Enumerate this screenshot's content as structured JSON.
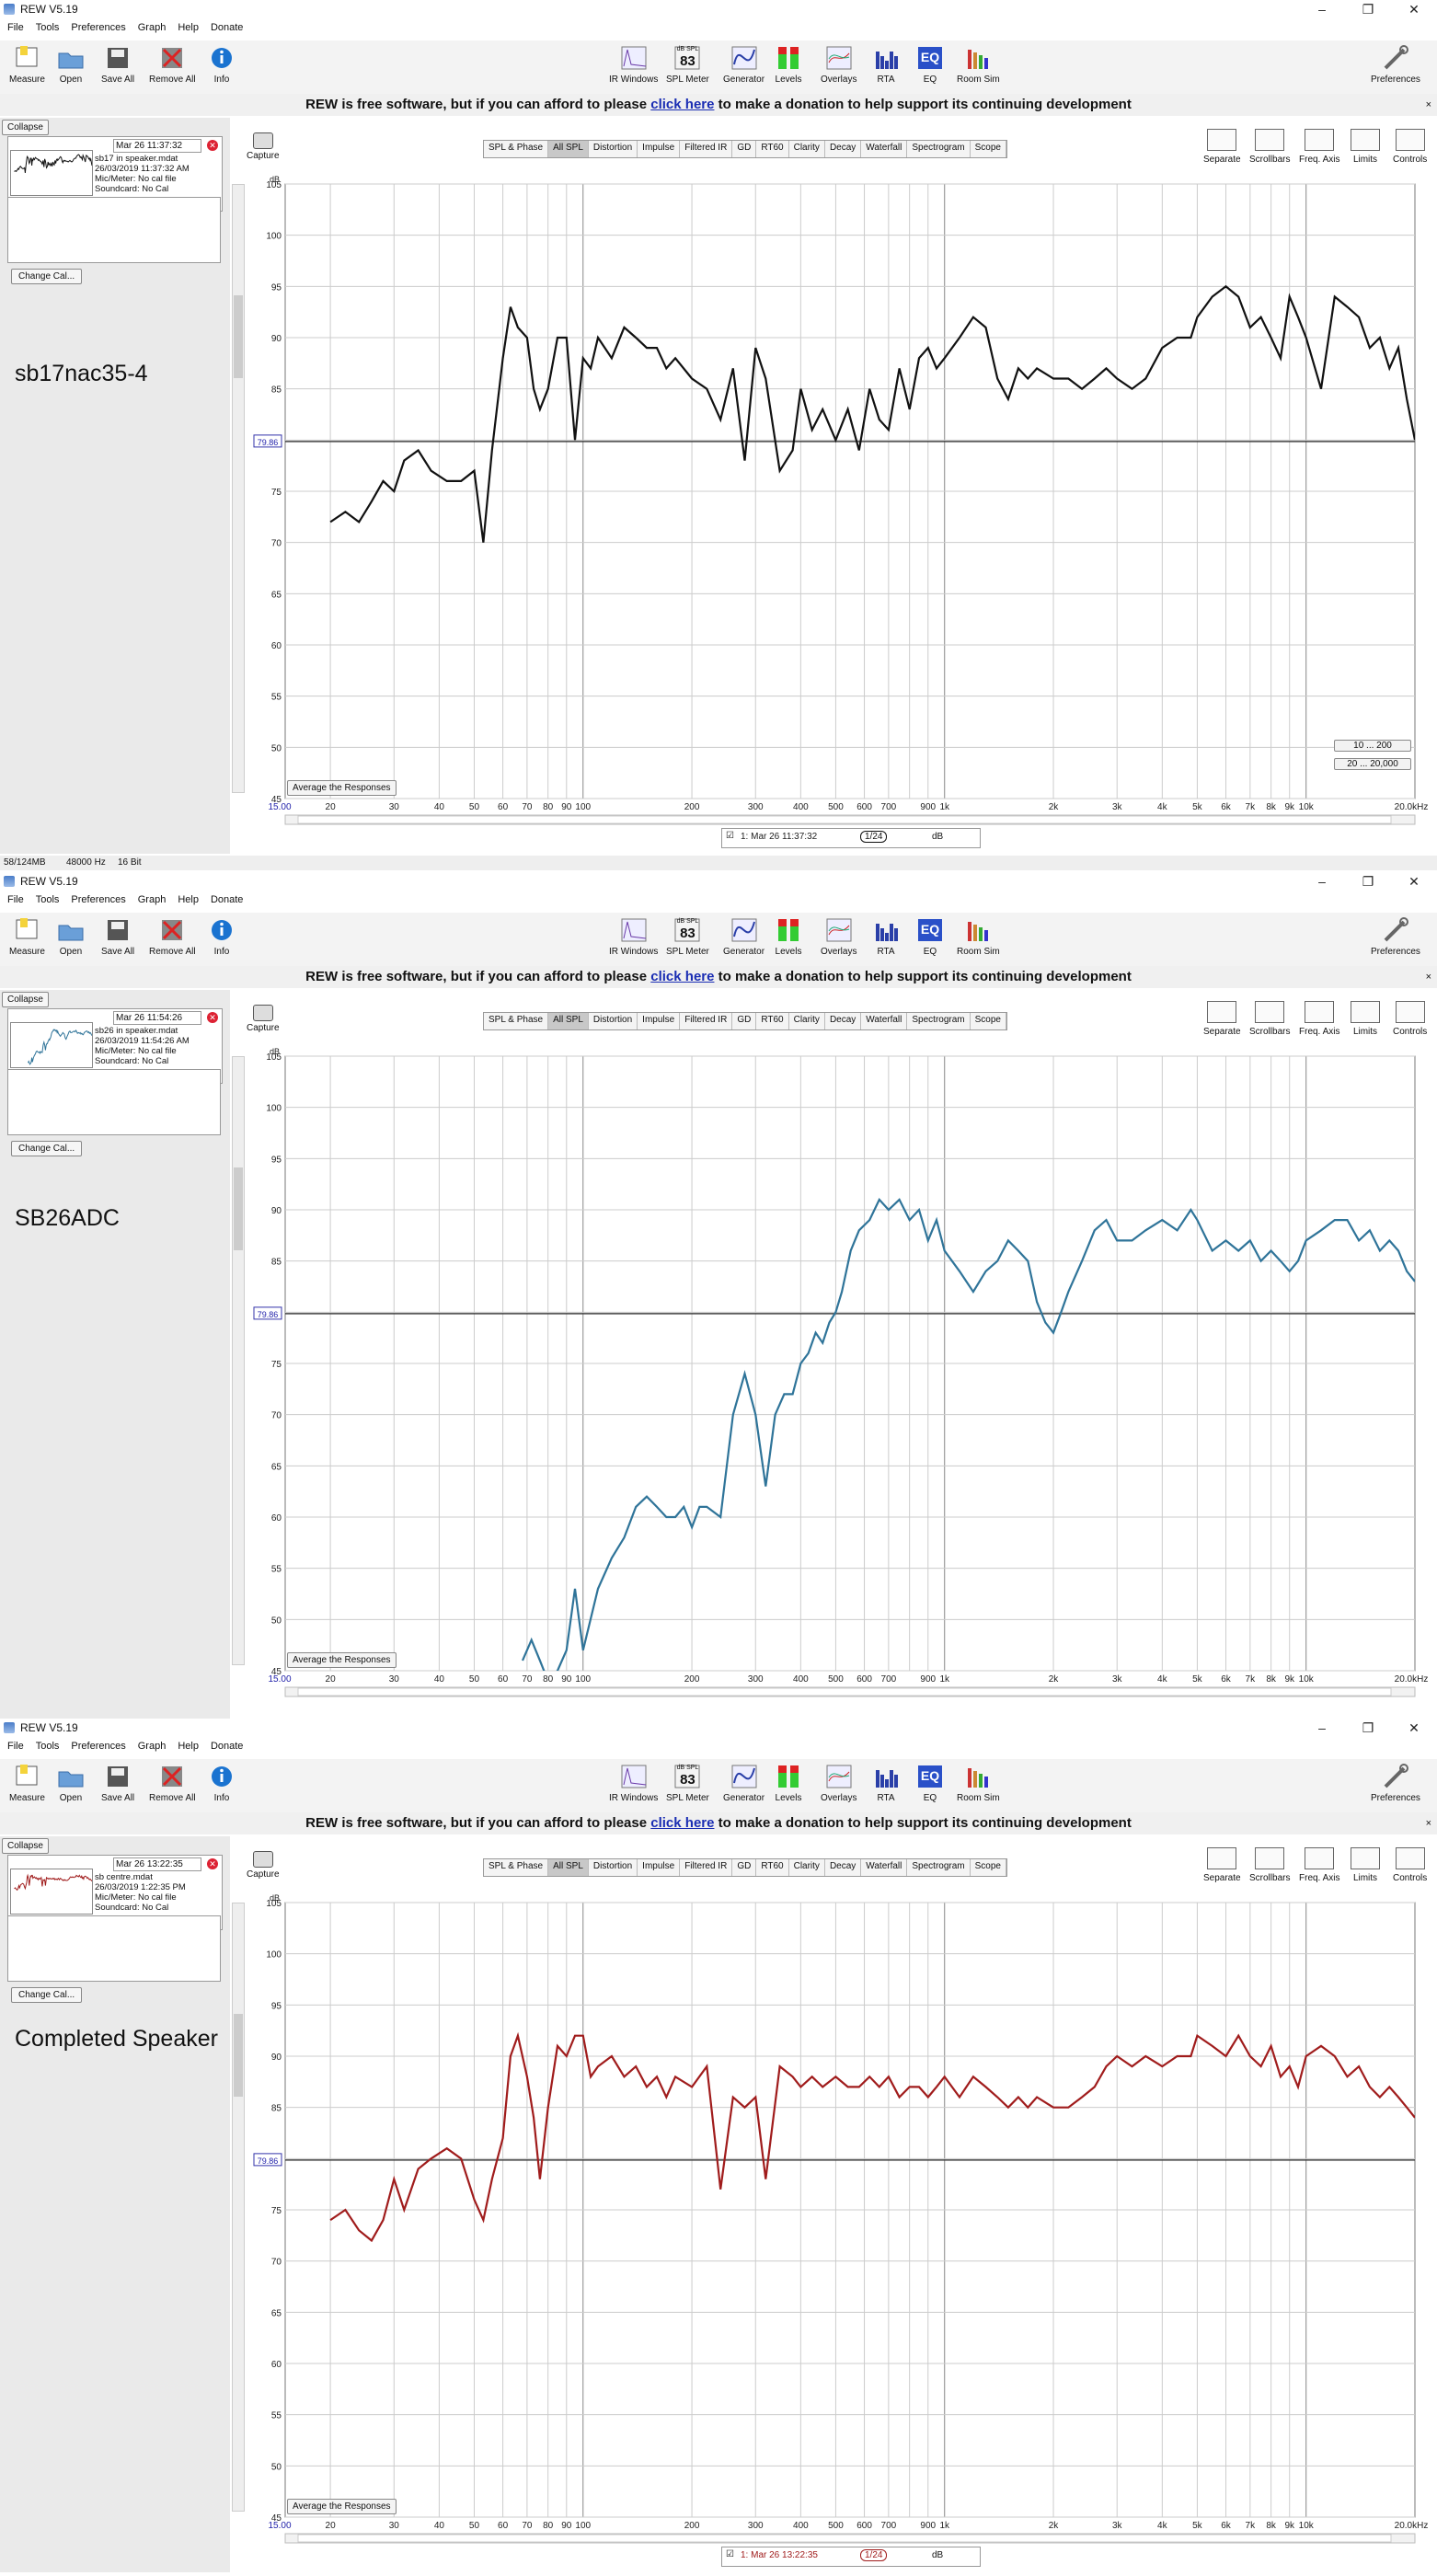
{
  "app": {
    "title": "REW V5.19",
    "menu": [
      "File",
      "Tools",
      "Preferences",
      "Graph",
      "Help",
      "Donate"
    ],
    "toolbar_left": [
      {
        "label": "Measure",
        "icon": "measure-icon"
      },
      {
        "label": "Open",
        "icon": "open-folder-icon"
      },
      {
        "label": "Save All",
        "icon": "save-icon"
      },
      {
        "label": "Remove All",
        "icon": "remove-icon"
      },
      {
        "label": "Info",
        "icon": "info-icon"
      }
    ],
    "toolbar_center": [
      {
        "label": "IR Windows",
        "icon": "ir-windows-icon"
      },
      {
        "label": "SPL Meter",
        "icon": "spl-meter-icon",
        "badge_top": "dB SPL",
        "badge": "83"
      },
      {
        "label": "Generator",
        "icon": "generator-icon"
      },
      {
        "label": "Levels",
        "icon": "levels-icon"
      },
      {
        "label": "Overlays",
        "icon": "overlays-icon"
      },
      {
        "label": "RTA",
        "icon": "rta-icon"
      },
      {
        "label": "EQ",
        "icon": "eq-icon"
      },
      {
        "label": "Room Sim",
        "icon": "room-sim-icon"
      }
    ],
    "preferences_label": "Preferences",
    "banner": {
      "pre": "REW is free software, but if you can afford to please ",
      "link": "click here",
      "post": " to make a donation to help support its continuing development",
      "close": "×"
    },
    "collapse_label": "Collapse",
    "change_cal_label": "Change Cal...",
    "capture_label": "Capture",
    "tabs": [
      "SPL & Phase",
      "All SPL",
      "Distortion",
      "Impulse",
      "Filtered IR",
      "GD",
      "RT60",
      "Clarity",
      "Decay",
      "Waterfall",
      "Spectrogram",
      "Scope"
    ],
    "right_tools": [
      "Separate",
      "Scrollbars",
      "Freq. Axis",
      "Limits",
      "Controls"
    ],
    "average_label": "Average the Responses",
    "range_buttons": [
      "10 ... 200",
      "20 ... 20,000"
    ],
    "status": {
      "mem": "58/124MB",
      "rate": "48000 Hz",
      "bits": "16 Bit"
    }
  },
  "windows": [
    {
      "panel_label": "sb17nac35-4",
      "meas_date_box": "Mar 26 11:37:32",
      "meas_name": "sb17 in speaker.mdat",
      "meas_date": "26/03/2019 11:37:32 AM",
      "meas_mic": "Mic/Meter: No cal file",
      "meas_card": "Soundcard: No Cal",
      "meas_index": "1",
      "legend": "1: Mar 26 11:37:32",
      "legend_color_text": "1/24",
      "legend_unit": "dB",
      "color": "#111111"
    },
    {
      "panel_label": "SB26ADC",
      "meas_date_box": "Mar 26 11:54:26",
      "meas_name": "sb26 in speaker.mdat",
      "meas_date": "26/03/2019 11:54:26 AM",
      "meas_mic": "Mic/Meter: No cal file",
      "meas_card": "Soundcard: No Cal",
      "meas_index": "1",
      "legend": "",
      "legend_color_text": "",
      "legend_unit": "",
      "color": "#2f7499"
    },
    {
      "panel_label": "Completed Speaker",
      "meas_date_box": "Mar 26 13:22:35",
      "meas_name": "sb centre.mdat",
      "meas_date": "26/03/2019 1:22:35 PM",
      "meas_mic": "Mic/Meter: No cal file",
      "meas_card": "Soundcard: No Cal",
      "meas_index": "1",
      "legend": "1: Mar 26 13:22:35",
      "legend_color_text": "1/24",
      "legend_unit": "dB",
      "color": "#a01c1c"
    }
  ],
  "chart_data": [
    {
      "type": "line",
      "xlabel": "",
      "ylabel": "dB",
      "x_scale": "log",
      "xlim": [
        15,
        20000
      ],
      "ylim": [
        45,
        105
      ],
      "y_ticks": [
        45,
        50,
        55,
        60,
        65,
        70,
        75,
        80,
        85,
        90,
        95,
        100,
        105
      ],
      "x_tick_labels": [
        "15.00",
        "20",
        "30",
        "40",
        "50",
        "60",
        "70",
        "80",
        "90",
        "100",
        "200",
        "300",
        "400",
        "500",
        "600",
        "700",
        "900",
        "1k",
        "2k",
        "3k",
        "4k",
        "5k",
        "6k",
        "7k",
        "8k",
        "9k",
        "10k",
        "20.0kHz"
      ],
      "reference_level": 79.86,
      "reference_label": "79.86",
      "grid": true,
      "series": [
        {
          "name": "1: Mar 26 11:37:32",
          "color": "#111111",
          "x": [
            20,
            22,
            24,
            26,
            28,
            30,
            32,
            35,
            38,
            42,
            46,
            50,
            53,
            56,
            60,
            63,
            66,
            70,
            73,
            76,
            80,
            85,
            90,
            95,
            100,
            105,
            110,
            120,
            130,
            140,
            150,
            160,
            170,
            180,
            200,
            220,
            240,
            260,
            280,
            300,
            320,
            350,
            380,
            400,
            430,
            460,
            500,
            540,
            580,
            620,
            660,
            700,
            750,
            800,
            850,
            900,
            950,
            1000,
            1100,
            1200,
            1300,
            1400,
            1500,
            1600,
            1700,
            1800,
            2000,
            2200,
            2400,
            2600,
            2800,
            3000,
            3300,
            3600,
            4000,
            4400,
            4800,
            5000,
            5500,
            6000,
            6500,
            7000,
            7500,
            8000,
            8500,
            9000,
            9500,
            10000,
            11000,
            12000,
            13000,
            14000,
            15000,
            16000,
            17000,
            18000,
            19000,
            20000
          ],
          "y": [
            72,
            73,
            72,
            74,
            76,
            75,
            78,
            79,
            77,
            76,
            76,
            77,
            70,
            79,
            88,
            93,
            91,
            90,
            85,
            83,
            85,
            90,
            90,
            80,
            88,
            87,
            90,
            88,
            91,
            90,
            89,
            89,
            87,
            88,
            86,
            85,
            82,
            87,
            78,
            89,
            86,
            77,
            79,
            85,
            81,
            83,
            80,
            83,
            79,
            85,
            82,
            81,
            87,
            83,
            88,
            89,
            87,
            88,
            90,
            92,
            91,
            86,
            84,
            87,
            86,
            87,
            86,
            86,
            85,
            86,
            87,
            86,
            85,
            86,
            89,
            90,
            90,
            92,
            94,
            95,
            94,
            91,
            92,
            90,
            88,
            94,
            92,
            90,
            85,
            94,
            93,
            92,
            89,
            90,
            87,
            89,
            84,
            80
          ]
        }
      ]
    },
    {
      "type": "line",
      "xlabel": "",
      "ylabel": "dB",
      "x_scale": "log",
      "xlim": [
        15,
        20000
      ],
      "ylim": [
        45,
        105
      ],
      "y_ticks": [
        45,
        50,
        55,
        60,
        65,
        70,
        75,
        80,
        85,
        90,
        95,
        100,
        105
      ],
      "x_tick_labels": [
        "15.00",
        "20",
        "30",
        "40",
        "50",
        "60",
        "70",
        "80",
        "90",
        "100",
        "200",
        "300",
        "400",
        "500",
        "600",
        "700",
        "900",
        "1k",
        "2k",
        "3k",
        "4k",
        "5k",
        "6k",
        "7k",
        "8k",
        "9k",
        "10k",
        "20.0kHz"
      ],
      "reference_level": 79.86,
      "reference_label": "79.86",
      "grid": true,
      "series": [
        {
          "name": "",
          "color": "#2f7499",
          "x": [
            68,
            72,
            76,
            80,
            85,
            90,
            95,
            100,
            110,
            120,
            130,
            140,
            150,
            160,
            170,
            180,
            190,
            200,
            210,
            220,
            240,
            260,
            280,
            300,
            320,
            340,
            360,
            380,
            400,
            420,
            440,
            460,
            480,
            500,
            520,
            550,
            580,
            620,
            660,
            700,
            750,
            800,
            850,
            900,
            950,
            1000,
            1100,
            1200,
            1300,
            1400,
            1500,
            1600,
            1700,
            1800,
            1900,
            2000,
            2100,
            2200,
            2400,
            2600,
            2800,
            3000,
            3300,
            3600,
            4000,
            4400,
            4800,
            5000,
            5500,
            6000,
            6500,
            7000,
            7500,
            8000,
            8500,
            9000,
            9500,
            10000,
            11000,
            12000,
            13000,
            14000,
            15000,
            16000,
            17000,
            18000,
            19000,
            20000
          ],
          "y": [
            46,
            48,
            46,
            44,
            45,
            47,
            53,
            47,
            53,
            56,
            58,
            61,
            62,
            61,
            60,
            60,
            61,
            59,
            61,
            61,
            60,
            70,
            74,
            70,
            63,
            70,
            72,
            72,
            75,
            76,
            78,
            77,
            79,
            80,
            82,
            86,
            88,
            89,
            91,
            90,
            91,
            89,
            90,
            87,
            89,
            86,
            84,
            82,
            84,
            85,
            87,
            86,
            85,
            81,
            79,
            78,
            80,
            82,
            85,
            88,
            89,
            87,
            87,
            88,
            89,
            88,
            90,
            89,
            86,
            87,
            86,
            87,
            85,
            86,
            85,
            84,
            85,
            87,
            88,
            89,
            89,
            87,
            88,
            86,
            87,
            86,
            84,
            83
          ]
        }
      ]
    },
    {
      "type": "line",
      "xlabel": "",
      "ylabel": "dB",
      "x_scale": "log",
      "xlim": [
        15,
        20000
      ],
      "ylim": [
        45,
        105
      ],
      "y_ticks": [
        45,
        50,
        55,
        60,
        65,
        70,
        75,
        80,
        85,
        90,
        95,
        100,
        105
      ],
      "x_tick_labels": [
        "15.00",
        "20",
        "30",
        "40",
        "50",
        "60",
        "70",
        "80",
        "90",
        "100",
        "200",
        "300",
        "400",
        "500",
        "600",
        "700",
        "900",
        "1k",
        "2k",
        "3k",
        "4k",
        "5k",
        "6k",
        "7k",
        "8k",
        "9k",
        "10k",
        "20.0kHz"
      ],
      "reference_level": 79.86,
      "reference_label": "79.86",
      "grid": true,
      "series": [
        {
          "name": "1: Mar 26 13:22:35",
          "color": "#a01c1c",
          "x": [
            20,
            22,
            24,
            26,
            28,
            30,
            32,
            35,
            38,
            42,
            46,
            50,
            53,
            56,
            60,
            63,
            66,
            70,
            73,
            76,
            80,
            85,
            90,
            95,
            100,
            105,
            110,
            120,
            130,
            140,
            150,
            160,
            170,
            180,
            200,
            220,
            240,
            260,
            280,
            300,
            320,
            350,
            380,
            400,
            430,
            460,
            500,
            540,
            580,
            620,
            660,
            700,
            750,
            800,
            850,
            900,
            950,
            1000,
            1100,
            1200,
            1300,
            1400,
            1500,
            1600,
            1700,
            1800,
            2000,
            2200,
            2400,
            2600,
            2800,
            3000,
            3300,
            3600,
            4000,
            4400,
            4800,
            5000,
            5500,
            6000,
            6500,
            7000,
            7500,
            8000,
            8500,
            9000,
            9500,
            10000,
            11000,
            12000,
            13000,
            14000,
            15000,
            16000,
            17000,
            18000,
            19000,
            20000
          ],
          "y": [
            74,
            75,
            73,
            72,
            74,
            78,
            75,
            79,
            80,
            81,
            80,
            76,
            74,
            78,
            82,
            90,
            92,
            88,
            84,
            78,
            85,
            91,
            90,
            92,
            92,
            88,
            89,
            90,
            88,
            89,
            87,
            88,
            86,
            88,
            87,
            89,
            77,
            86,
            85,
            86,
            78,
            89,
            88,
            87,
            88,
            87,
            88,
            87,
            87,
            88,
            87,
            88,
            86,
            87,
            87,
            86,
            87,
            88,
            86,
            88,
            87,
            86,
            85,
            86,
            85,
            86,
            85,
            85,
            86,
            87,
            89,
            90,
            89,
            90,
            89,
            90,
            90,
            92,
            91,
            90,
            92,
            90,
            89,
            91,
            88,
            89,
            87,
            90,
            91,
            90,
            88,
            89,
            87,
            86,
            87,
            86,
            85,
            84
          ]
        }
      ]
    }
  ]
}
